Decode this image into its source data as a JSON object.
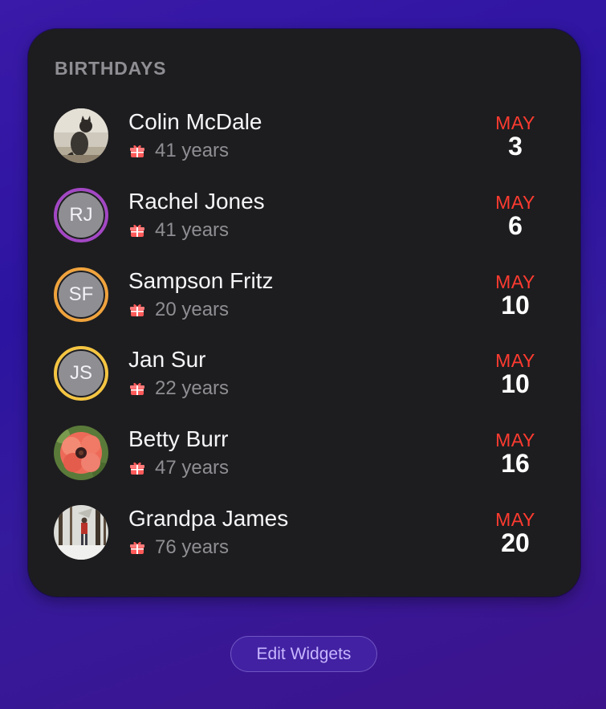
{
  "widget": {
    "title": "BIRTHDAYS",
    "people": [
      {
        "name": "Colin McDale",
        "age": "41 years",
        "month": "MAY",
        "day": "3",
        "avatar": {
          "type": "photo",
          "subject": "cat"
        }
      },
      {
        "name": "Rachel Jones",
        "age": "41 years",
        "month": "MAY",
        "day": "6",
        "avatar": {
          "type": "initials",
          "initials": "RJ",
          "ring_color": "#a347c4"
        }
      },
      {
        "name": "Sampson Fritz",
        "age": "20 years",
        "month": "MAY",
        "day": "10",
        "avatar": {
          "type": "initials",
          "initials": "SF",
          "ring_color": "#f0a33c"
        }
      },
      {
        "name": "Jan Sur",
        "age": "22 years",
        "month": "MAY",
        "day": "10",
        "avatar": {
          "type": "initials",
          "initials": "JS",
          "ring_color": "#f5c542"
        }
      },
      {
        "name": "Betty Burr",
        "age": "47 years",
        "month": "MAY",
        "day": "16",
        "avatar": {
          "type": "photo",
          "subject": "poppy-flower"
        }
      },
      {
        "name": "Grandpa James",
        "age": "76 years",
        "month": "MAY",
        "day": "20",
        "avatar": {
          "type": "photo",
          "subject": "snowy-forest"
        }
      }
    ],
    "icon": "gift-icon",
    "colors": {
      "month": "#ff3b30",
      "background": "#1d1d1f"
    }
  },
  "edit_button": {
    "label": "Edit Widgets"
  }
}
